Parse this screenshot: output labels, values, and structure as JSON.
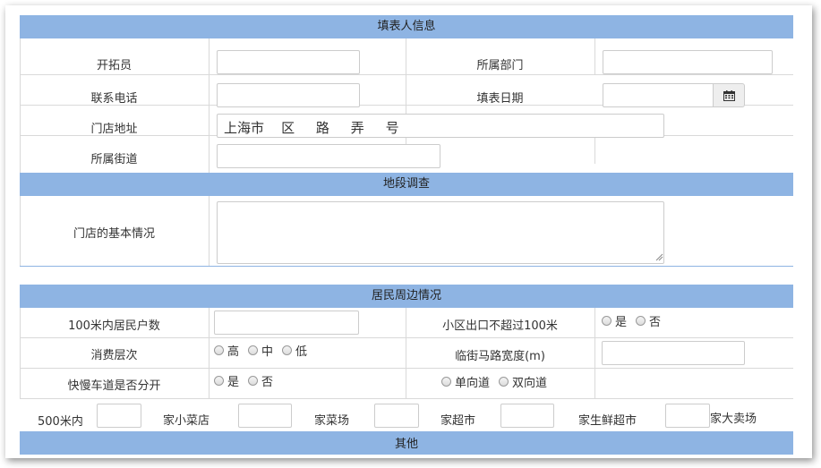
{
  "sections": {
    "filler_info": "填表人信息",
    "site_survey": "地段调查",
    "residents": "居民周边情况",
    "other": "其他"
  },
  "filler": {
    "developer_label": "开拓员",
    "department_label": "所属部门",
    "phone_label": "联系电话",
    "date_label": "填表日期",
    "address_label": "门店地址",
    "address_value": "上海市    区     路     弄     号",
    "street_label": "所属街道"
  },
  "site": {
    "basic_label": "门店的基本情况"
  },
  "residents": {
    "households_label": "100米内居民户数",
    "exit_label": "小区出口不超过100米",
    "exit_options": [
      "是",
      "否"
    ],
    "consumption_label": "消费层次",
    "consumption_options": [
      "高",
      "中",
      "低"
    ],
    "road_width_label": "临街马路宽度(m)",
    "lane_label": "快慢车道是否分开",
    "lane_options": [
      "是",
      "否"
    ],
    "direction_options": [
      "单向道",
      "双向道"
    ]
  },
  "within500": {
    "prefix": "500米内",
    "small_store": "家小菜店",
    "market": "家菜场",
    "supermarket": "家超市",
    "fresh_supermarket": "家生鲜超市",
    "hypermarket": "家大卖场"
  },
  "icons": {
    "calendar": "calendar-icon"
  },
  "colors": {
    "header_bg": "#8eb4e3",
    "border": "#d9d9d9"
  }
}
